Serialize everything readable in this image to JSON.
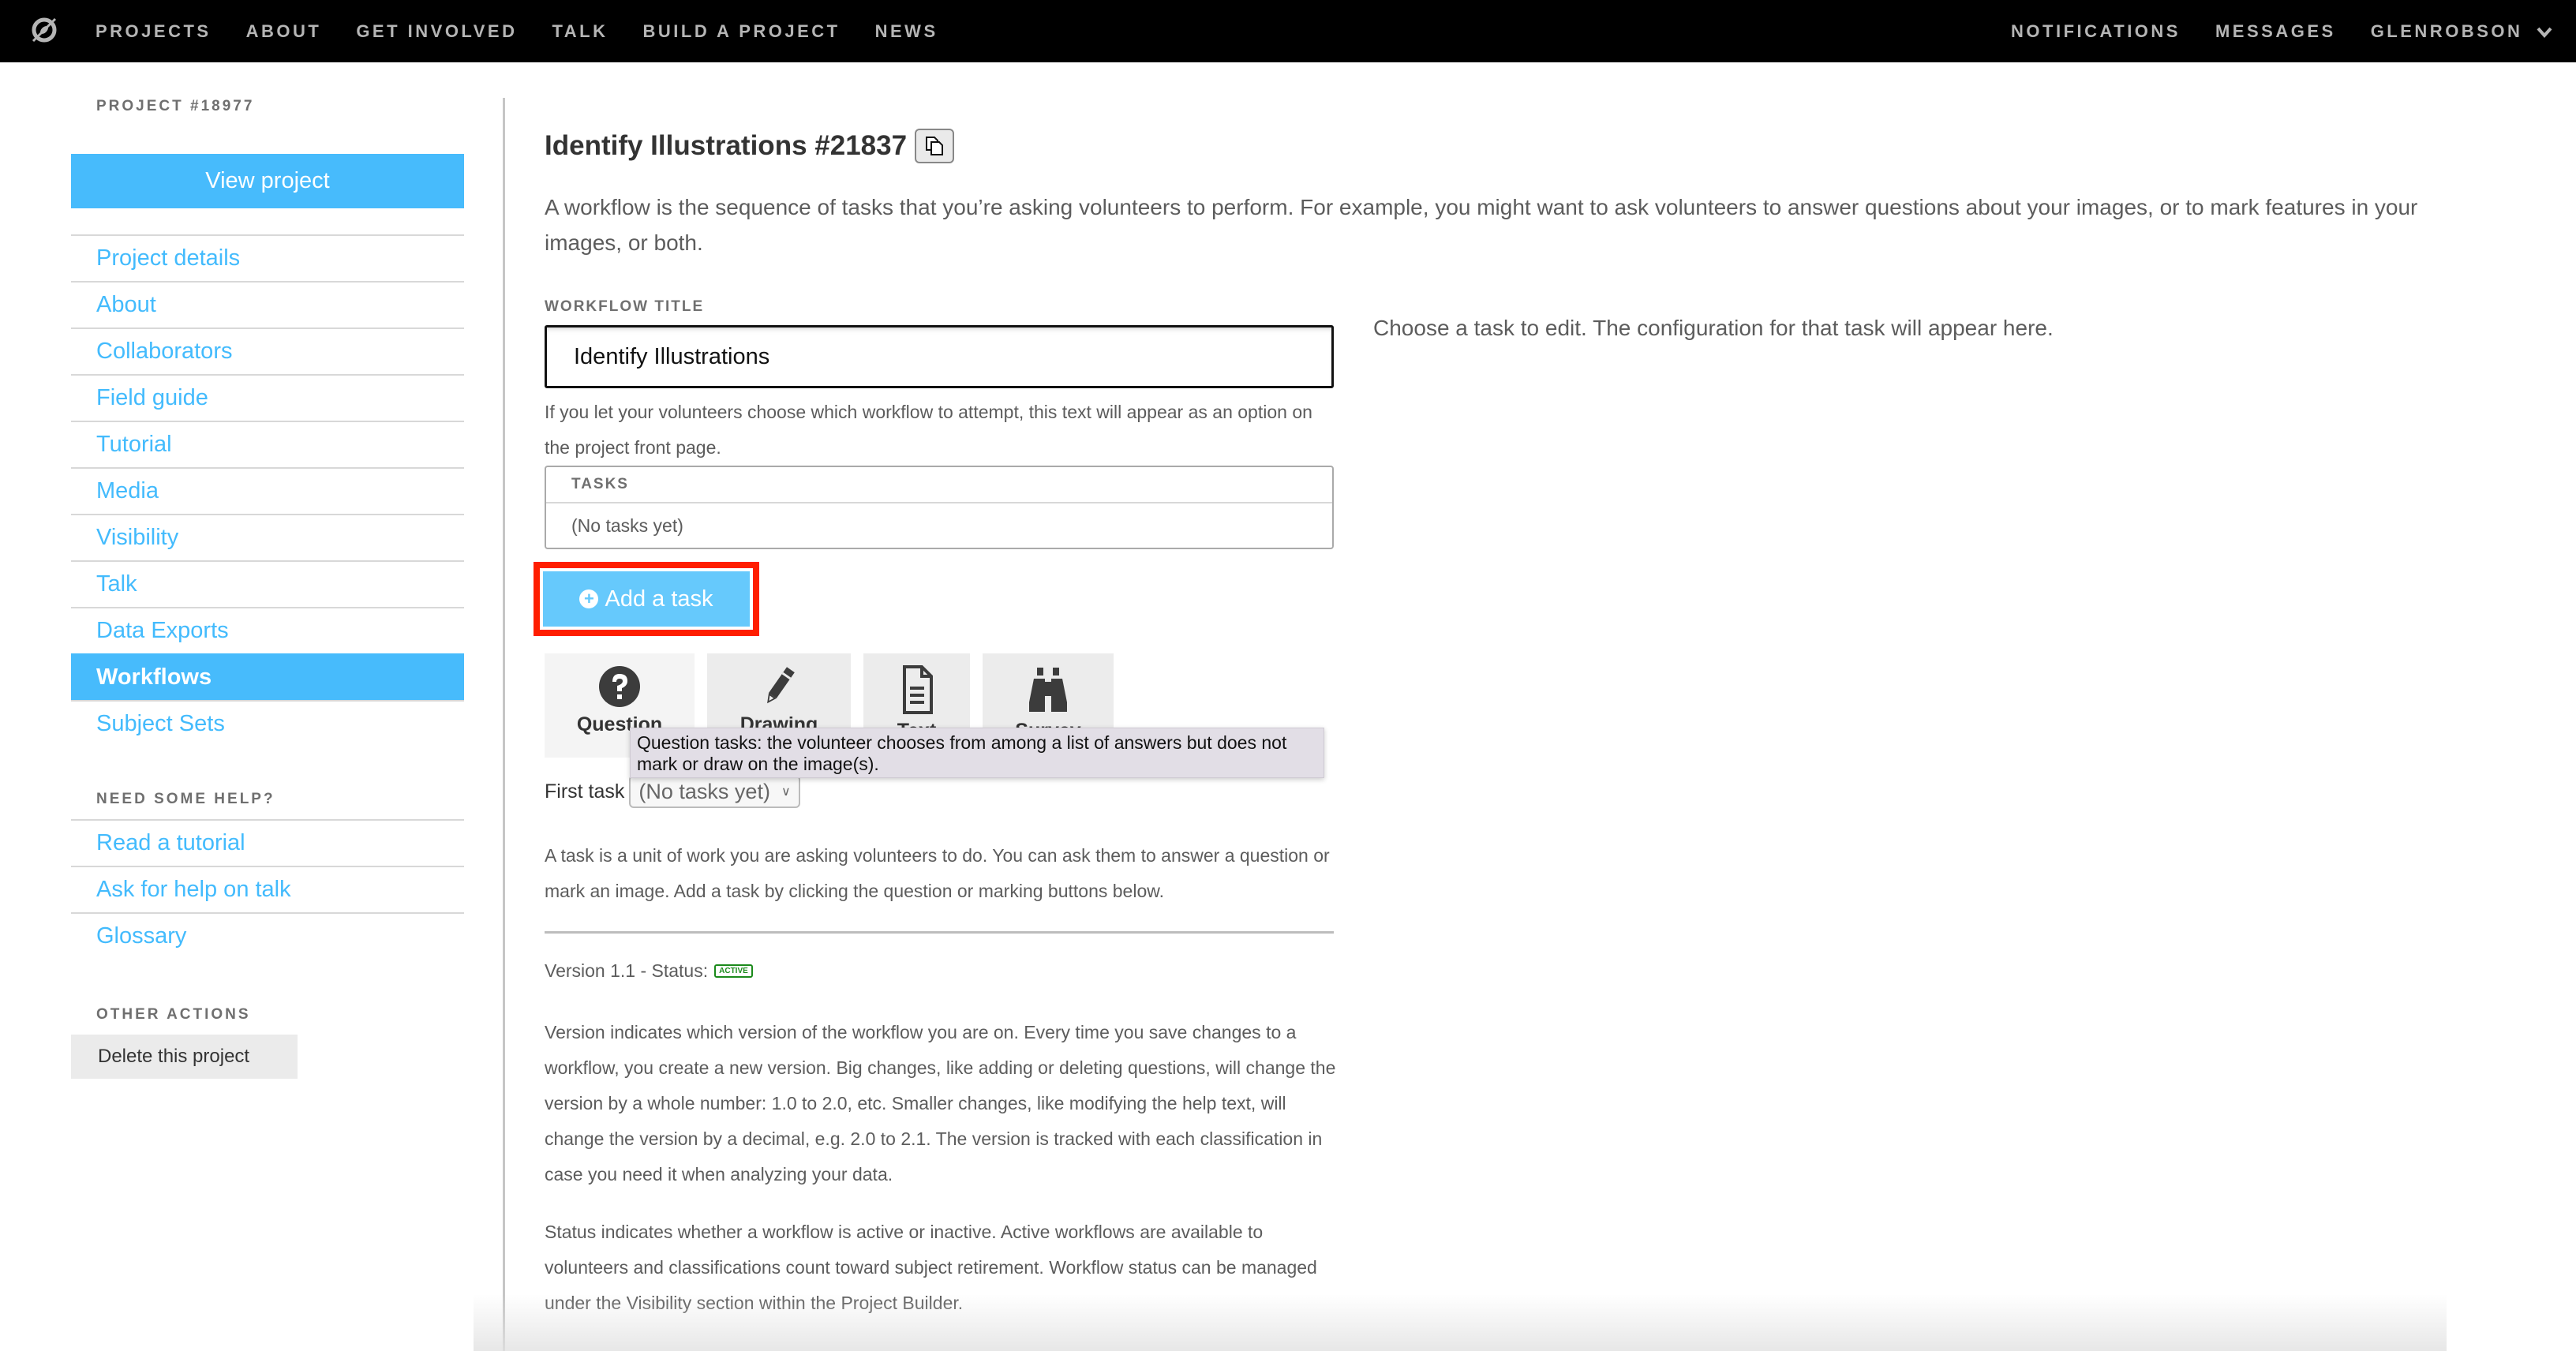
{
  "nav": {
    "left": [
      "PROJECTS",
      "ABOUT",
      "GET INVOLVED",
      "TALK",
      "BUILD A PROJECT",
      "NEWS"
    ],
    "right": [
      "NOTIFICATIONS",
      "MESSAGES",
      "GLENROBSON"
    ]
  },
  "sidebar": {
    "project_label": "PROJECT #18977",
    "view_project": "View project",
    "items": [
      {
        "label": "Project details"
      },
      {
        "label": "About"
      },
      {
        "label": "Collaborators"
      },
      {
        "label": "Field guide"
      },
      {
        "label": "Tutorial"
      },
      {
        "label": "Media"
      },
      {
        "label": "Visibility"
      },
      {
        "label": "Talk"
      },
      {
        "label": "Data Exports"
      },
      {
        "label": "Workflows",
        "active": true
      },
      {
        "label": "Subject Sets"
      }
    ],
    "help_heading": "NEED SOME HELP?",
    "help_items": [
      "Read a tutorial",
      "Ask for help on talk",
      "Glossary"
    ],
    "other_heading": "OTHER ACTIONS",
    "delete_label": "Delete this project"
  },
  "main": {
    "title": "Identify Illustrations #21837",
    "intro": "A workflow is the sequence of tasks that you’re asking volunteers to perform. For example, you might want to ask volunteers to answer questions about your images, or to mark features in your images, or both.",
    "workflow_title_label": "WORKFLOW TITLE",
    "workflow_title_value": "Identify Illustrations",
    "workflow_title_hint": "If you let your volunteers choose which workflow to attempt, this text will appear as an option on the project front page.",
    "tasks_label": "TASKS",
    "tasks_empty": "(No tasks yet)",
    "add_task": "Add a task",
    "task_types": [
      {
        "icon": "question-circle-icon",
        "label": "Question"
      },
      {
        "icon": "pencil-icon",
        "label": "Drawing"
      },
      {
        "icon": "document-icon",
        "label": "Text"
      },
      {
        "icon": "binoculars-icon",
        "label": "Survey"
      }
    ],
    "tooltip": "Question tasks: the volunteer chooses from among a list of answers but does not mark or draw on the image(s).",
    "first_task_label": "First task",
    "first_task_value": "(No tasks yet)",
    "task_explain": "A task is a unit of work you are asking volunteers to do. You can ask them to answer a question or mark an image. Add a task by clicking the question or marking buttons below.",
    "version_label": "Version 1.1 - Status:",
    "status_badge": "ACTIVE",
    "version_explain": "Version indicates which version of the workflow you are on. Every time you save changes to a workflow, you create a new version. Big changes, like adding or deleting questions, will change the version by a whole number: 1.0 to 2.0, etc. Smaller changes, like modifying the help text, will change the version by a decimal, e.g. 2.0 to 2.1. The version is tracked with each classification in case you need it when analyzing your data.",
    "status_explain": "Status indicates whether a workflow is active or inactive. Active workflows are available to volunteers and classifications count toward subject retirement. Workflow status can be managed under the Visibility section within the Project Builder.",
    "right_panel": "Choose a task to edit. The configuration for that task will appear here."
  },
  "colors": {
    "accent": "#47bbfc",
    "highlight": "#ff1e00",
    "active_status": "#1b8a1b"
  }
}
